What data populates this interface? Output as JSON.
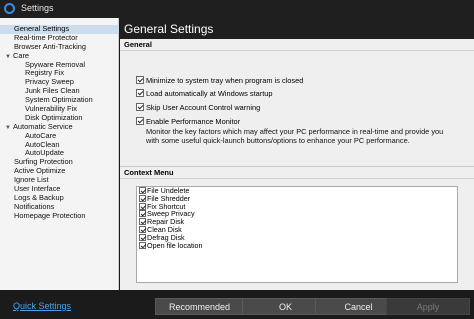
{
  "window": {
    "title": "Settings",
    "app_icon": "app-logo-icon"
  },
  "sidebar": {
    "items": [
      {
        "label": "General Settings",
        "level": 0,
        "selected": true
      },
      {
        "label": "Real-time Protector",
        "level": 0
      },
      {
        "label": "Browser Anti-Tracking",
        "level": 0
      },
      {
        "label": "Care",
        "level": 0,
        "expander": "collapse-arrow-icon"
      },
      {
        "label": "Spyware Removal",
        "level": 1
      },
      {
        "label": "Registry Fix",
        "level": 1
      },
      {
        "label": "Privacy Sweep",
        "level": 1
      },
      {
        "label": "Junk Files Clean",
        "level": 1
      },
      {
        "label": "System Optimization",
        "level": 1
      },
      {
        "label": "Vulnerability Fix",
        "level": 1
      },
      {
        "label": "Disk Optimization",
        "level": 1
      },
      {
        "label": "Automatic Service",
        "level": 0,
        "expander": "collapse-arrow-icon"
      },
      {
        "label": "AutoCare",
        "level": 1
      },
      {
        "label": "AutoClean",
        "level": 1
      },
      {
        "label": "AutoUpdate",
        "level": 1
      },
      {
        "label": "Surfing Protection",
        "level": 0
      },
      {
        "label": "Active Optimize",
        "level": 0
      },
      {
        "label": "Ignore List",
        "level": 0
      },
      {
        "label": "User Interface",
        "level": 0
      },
      {
        "label": "Logs & Backup",
        "level": 0
      },
      {
        "label": "Notifications",
        "level": 0
      },
      {
        "label": "Homepage Protection",
        "level": 0
      }
    ]
  },
  "main": {
    "title": "General Settings",
    "general": {
      "title": "General",
      "options": [
        {
          "label": "Minimize to system tray when program is closed",
          "checked": true
        },
        {
          "label": "Load automatically at Windows startup",
          "checked": true
        },
        {
          "label": "Skip User Account Control warning",
          "checked": true
        },
        {
          "label": "Enable Performance Monitor",
          "checked": true
        }
      ],
      "description": "Monitor the key factors which may affect your PC performance in real-time and provide you with some useful quick-launch buttons/options to enhance your PC performance."
    },
    "context": {
      "title": "Context Menu",
      "items": [
        {
          "label": "File Undelete",
          "checked": true
        },
        {
          "label": "File Shredder",
          "checked": true
        },
        {
          "label": "Fix Shortcut",
          "checked": true
        },
        {
          "label": "Sweep Privacy",
          "checked": true
        },
        {
          "label": "Repair Disk",
          "checked": true
        },
        {
          "label": "Clean Disk",
          "checked": true
        },
        {
          "label": "Defrag Disk",
          "checked": true
        },
        {
          "label": "Open file location",
          "checked": true
        }
      ]
    }
  },
  "footer": {
    "quick_settings": "Quick Settings",
    "recommended": "Recommended",
    "ok": "OK",
    "cancel": "Cancel",
    "apply": "Apply"
  }
}
